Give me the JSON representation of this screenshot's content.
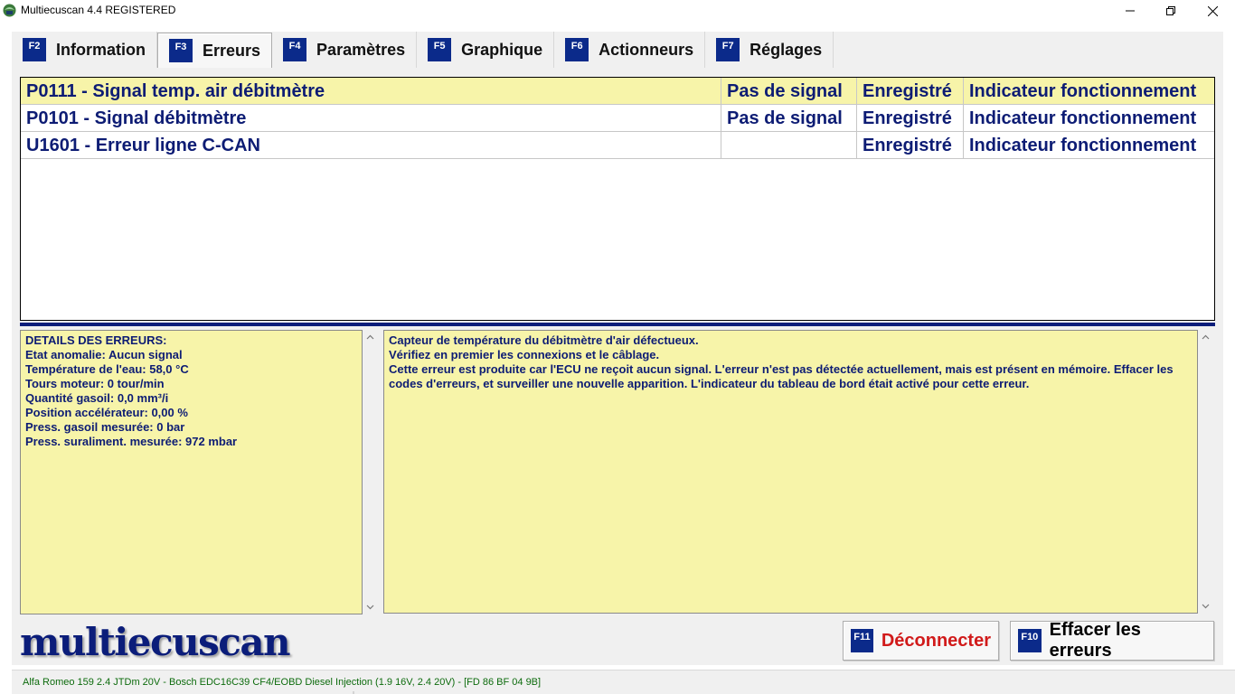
{
  "window": {
    "title": "Multiecuscan 4.4 REGISTERED",
    "icon": "app-icon"
  },
  "tabs": [
    {
      "key": "F2",
      "label": "Information",
      "active": false
    },
    {
      "key": "F3",
      "label": "Erreurs",
      "active": true
    },
    {
      "key": "F4",
      "label": "Paramètres",
      "active": false
    },
    {
      "key": "F5",
      "label": "Graphique",
      "active": false
    },
    {
      "key": "F6",
      "label": "Actionneurs",
      "active": false
    },
    {
      "key": "F7",
      "label": "Réglages",
      "active": false
    }
  ],
  "errors": [
    {
      "code": "P0111 - Signal temp. air débitmètre",
      "signal": "Pas de signal",
      "status": "Enregistré",
      "indicator": "Indicateur fonctionnement",
      "selected": true
    },
    {
      "code": "P0101 - Signal débitmètre",
      "signal": "Pas de signal",
      "status": "Enregistré",
      "indicator": "Indicateur fonctionnement",
      "selected": false
    },
    {
      "code": "U1601 - Erreur ligne C-CAN",
      "signal": "",
      "status": "Enregistré",
      "indicator": "Indicateur fonctionnement",
      "selected": false
    }
  ],
  "details": {
    "lines": [
      "DETAILS DES ERREURS:",
      "Etat anomalie: Aucun signal",
      "Température de l'eau: 58,0 °C",
      "Tours moteur: 0 tour/min",
      "Quantité gasoil: 0,0 mm³/i",
      "Position accélérateur: 0,00 %",
      "Press. gasoil mesurée: 0 bar",
      "Press. suraliment. mesurée: 972 mbar"
    ]
  },
  "description": {
    "lines": [
      "Capteur de température du débitmètre d'air défectueux.",
      "Vérifiez en premier les connexions et le câblage.",
      "Cette erreur est produite car l'ECU ne reçoit aucun signal. L'erreur n'est pas détectée actuellement, mais est présent en mémoire. Effacer les codes d'erreurs, et surveiller une nouvelle apparition. L'indicateur du tableau de bord était activé pour cette erreur."
    ]
  },
  "logo": "multiecuscan",
  "buttons": {
    "disconnect": {
      "key": "F11",
      "label": "Déconnecter"
    },
    "clear": {
      "key": "F10",
      "label": "Effacer les erreurs"
    }
  },
  "status": {
    "vehicle": "Alfa Romeo 159 2.4 JTDm 20V - Bosch EDC16C39 CF4/EOBD Diesel Injection (1.9 16V, 2.4 20V) - [FD 86 BF 04 9B]"
  },
  "colors": {
    "accent": "#0b1d7a",
    "fkey_bg": "#0b2a8a",
    "highlight": "#f7f4a9",
    "error_text": "#0d1c74",
    "disconnect_text": "#d11a1a",
    "status_text": "#0d6b0d"
  }
}
